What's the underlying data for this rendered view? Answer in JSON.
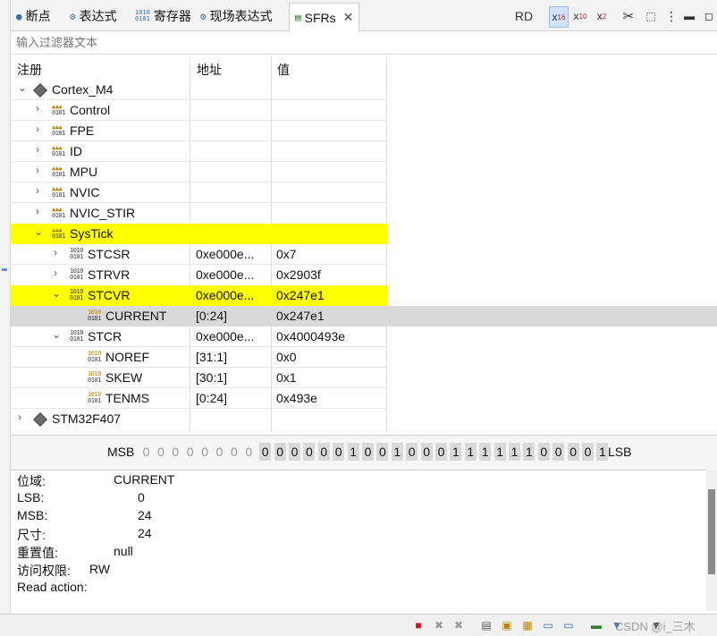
{
  "tabs": [
    {
      "label": "断点",
      "icon": "breakpoint-icon"
    },
    {
      "label": "表达式",
      "icon": "expression-icon"
    },
    {
      "label": "寄存器",
      "icon": "register-icon"
    },
    {
      "label": "现场表达式",
      "icon": "live-expression-icon"
    },
    {
      "label": "SFRs",
      "icon": "sfr-icon",
      "active": true
    }
  ],
  "toolbar": {
    "rd_label": "RD",
    "hex_label": "x",
    "hex_sub": "16",
    "dec_label": "x",
    "dec_sub": "10",
    "bin_label": "x",
    "bin_sub": "2"
  },
  "filter": {
    "placeholder": "输入过滤器文本"
  },
  "table": {
    "columns": [
      "注册",
      "地址",
      "值"
    ],
    "rows": [
      {
        "name": "Cortex_M4",
        "address": "",
        "value": "",
        "level": 0,
        "expanded": true,
        "icon": "chip-icon"
      },
      {
        "name": "Control",
        "address": "",
        "value": "",
        "level": 1,
        "expanded": false,
        "icon": "register-group-icon"
      },
      {
        "name": "FPE",
        "address": "",
        "value": "",
        "level": 1,
        "expanded": false,
        "icon": "register-group-icon"
      },
      {
        "name": "ID",
        "address": "",
        "value": "",
        "level": 1,
        "expanded": false,
        "icon": "register-group-icon"
      },
      {
        "name": "MPU",
        "address": "",
        "value": "",
        "level": 1,
        "expanded": false,
        "icon": "register-group-icon"
      },
      {
        "name": "NVIC",
        "address": "",
        "value": "",
        "level": 1,
        "expanded": false,
        "icon": "register-group-icon"
      },
      {
        "name": "NVIC_STIR",
        "address": "",
        "value": "",
        "level": 1,
        "expanded": false,
        "icon": "register-group-icon"
      },
      {
        "name": "SysTick",
        "address": "",
        "value": "",
        "level": 1,
        "expanded": true,
        "icon": "register-group-icon",
        "highlight": "yellow"
      },
      {
        "name": "STCSR",
        "address": "0xe000e...",
        "value": "0x7",
        "level": 2,
        "expanded": false,
        "icon": "register-icon"
      },
      {
        "name": "STRVR",
        "address": "0xe000e...",
        "value": "0x2903f",
        "level": 2,
        "expanded": false,
        "icon": "register-icon"
      },
      {
        "name": "STCVR",
        "address": "0xe000e...",
        "value": "0x247e1",
        "level": 2,
        "expanded": true,
        "icon": "register-icon",
        "highlight": "yellow"
      },
      {
        "name": "CURRENT",
        "address": "[0:24]",
        "value": "0x247e1",
        "level": 3,
        "icon": "field-icon",
        "highlight": "gray"
      },
      {
        "name": "STCR",
        "address": "0xe000e...",
        "value": "0x4000493e",
        "level": 2,
        "expanded": true,
        "icon": "register-icon"
      },
      {
        "name": "NOREF",
        "address": "[31:1]",
        "value": "0x0",
        "level": 3,
        "icon": "field-icon"
      },
      {
        "name": "SKEW",
        "address": "[30:1]",
        "value": "0x1",
        "level": 3,
        "icon": "field-icon"
      },
      {
        "name": "TENMS",
        "address": "[0:24]",
        "value": "0x493e",
        "level": 3,
        "icon": "field-icon"
      },
      {
        "name": "STM32F407",
        "address": "",
        "value": "",
        "level": 0,
        "expanded": false,
        "icon": "chip-icon"
      }
    ]
  },
  "bits": {
    "msb_label": "MSB",
    "lsb_label": "LSB",
    "inactive": [
      "0",
      "0",
      "0",
      "0",
      "0",
      "0",
      "0",
      "0"
    ],
    "active": [
      "0",
      "0",
      "0",
      "0",
      "0",
      "0",
      "1",
      "0",
      "0",
      "1",
      "0",
      "0",
      "0",
      "1",
      "1",
      "1",
      "1",
      "1",
      "1",
      "0",
      "0",
      "0",
      "0",
      "1"
    ]
  },
  "details": [
    {
      "key": "位域:",
      "value": "CURRENT"
    },
    {
      "key": "LSB:",
      "value": "0"
    },
    {
      "key": "MSB:",
      "value": "24"
    },
    {
      "key": "尺寸:",
      "value": "24"
    },
    {
      "key": "重置值:",
      "value": "null"
    },
    {
      "key": "访问权限:",
      "value": "RW"
    },
    {
      "key": "Read action:",
      "value": ""
    }
  ],
  "watermark": "CSDN @i_三木"
}
